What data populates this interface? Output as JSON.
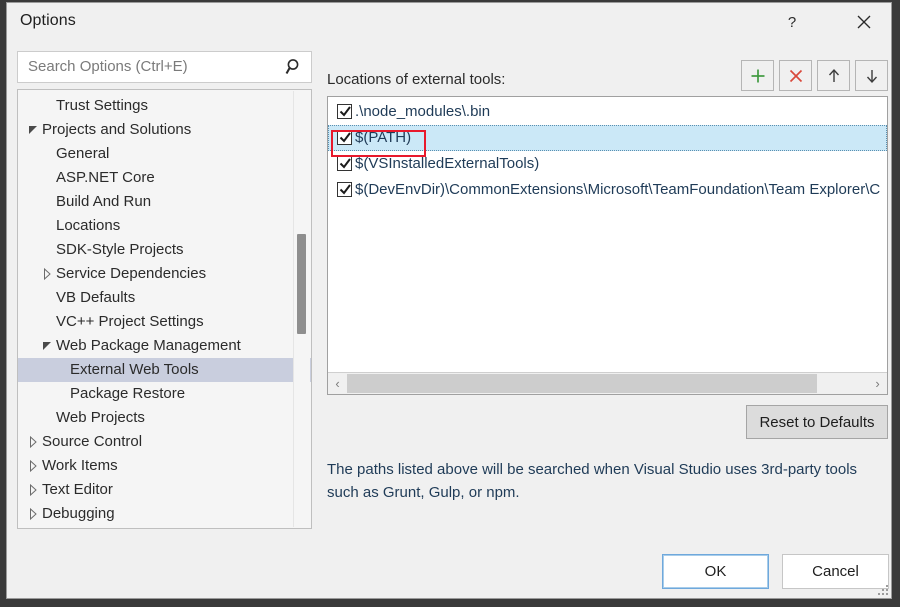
{
  "window": {
    "title": "Options",
    "help_icon": "question-mark-icon",
    "close_icon": "close-icon"
  },
  "search": {
    "placeholder": "Search Options (Ctrl+E)",
    "value": "",
    "icon": "search-icon"
  },
  "tree": {
    "items": [
      {
        "label": "Trust Settings",
        "indent": 38,
        "arrow": "",
        "selected": false
      },
      {
        "label": "Projects and Solutions",
        "indent": 24,
        "arrow": "▲",
        "selected": false
      },
      {
        "label": "General",
        "indent": 38,
        "arrow": "",
        "selected": false
      },
      {
        "label": "ASP.NET Core",
        "indent": 38,
        "arrow": "",
        "selected": false
      },
      {
        "label": "Build And Run",
        "indent": 38,
        "arrow": "",
        "selected": false
      },
      {
        "label": "Locations",
        "indent": 38,
        "arrow": "",
        "selected": false
      },
      {
        "label": "SDK-Style Projects",
        "indent": 38,
        "arrow": "",
        "selected": false
      },
      {
        "label": "Service Dependencies",
        "indent": 38,
        "arrow": "▶",
        "selected": false
      },
      {
        "label": "VB Defaults",
        "indent": 38,
        "arrow": "",
        "selected": false
      },
      {
        "label": "VC++ Project Settings",
        "indent": 38,
        "arrow": "",
        "selected": false
      },
      {
        "label": "Web Package Management",
        "indent": 38,
        "arrow": "▲",
        "selected": false
      },
      {
        "label": "External Web Tools",
        "indent": 52,
        "arrow": "",
        "selected": true
      },
      {
        "label": "Package Restore",
        "indent": 52,
        "arrow": "",
        "selected": false
      },
      {
        "label": "Web Projects",
        "indent": 38,
        "arrow": "",
        "selected": false
      },
      {
        "label": "Source Control",
        "indent": 24,
        "arrow": "▶",
        "selected": false
      },
      {
        "label": "Work Items",
        "indent": 24,
        "arrow": "▶",
        "selected": false
      },
      {
        "label": "Text Editor",
        "indent": 24,
        "arrow": "▶",
        "selected": false
      },
      {
        "label": "Debugging",
        "indent": 24,
        "arrow": "▶",
        "selected": false
      }
    ]
  },
  "main": {
    "list_caption": "Locations of external tools:",
    "toolbar": [
      {
        "name": "add-location-button",
        "icon": "plus-icon",
        "color": "#3f9a3f"
      },
      {
        "name": "delete-location-button",
        "icon": "close-x-icon",
        "color": "#d9483b"
      },
      {
        "name": "move-up-button",
        "icon": "arrow-up-icon",
        "color": "#3c3c3c"
      },
      {
        "name": "move-down-button",
        "icon": "arrow-down-icon",
        "color": "#3c3c3c"
      }
    ],
    "locations": [
      {
        "label": ".\\node_modules\\.bin",
        "checked": true,
        "selected": false
      },
      {
        "label": "$(PATH)",
        "checked": true,
        "selected": true
      },
      {
        "label": "$(VSInstalledExternalTools)",
        "checked": true,
        "selected": false
      },
      {
        "label": "$(DevEnvDir)\\CommonExtensions\\Microsoft\\TeamFoundation\\Team Explorer\\C",
        "checked": true,
        "selected": false
      }
    ],
    "hscroll": {
      "left_arrow": "‹",
      "right_arrow": "›"
    },
    "reset_button": "Reset to Defaults",
    "description": "The paths listed above will be searched when Visual Studio uses 3rd-party tools such as Grunt, Gulp, or npm."
  },
  "footer": {
    "ok_label": "OK",
    "cancel_label": "Cancel"
  },
  "colors": {
    "accent_selection_list": "#cbe8f7",
    "accent_selection_tree": "#c9cede",
    "annotation_red": "#e8192c",
    "add_green": "#3f9a3f",
    "delete_red": "#d9483b",
    "text_blue": "#1f3b57"
  }
}
